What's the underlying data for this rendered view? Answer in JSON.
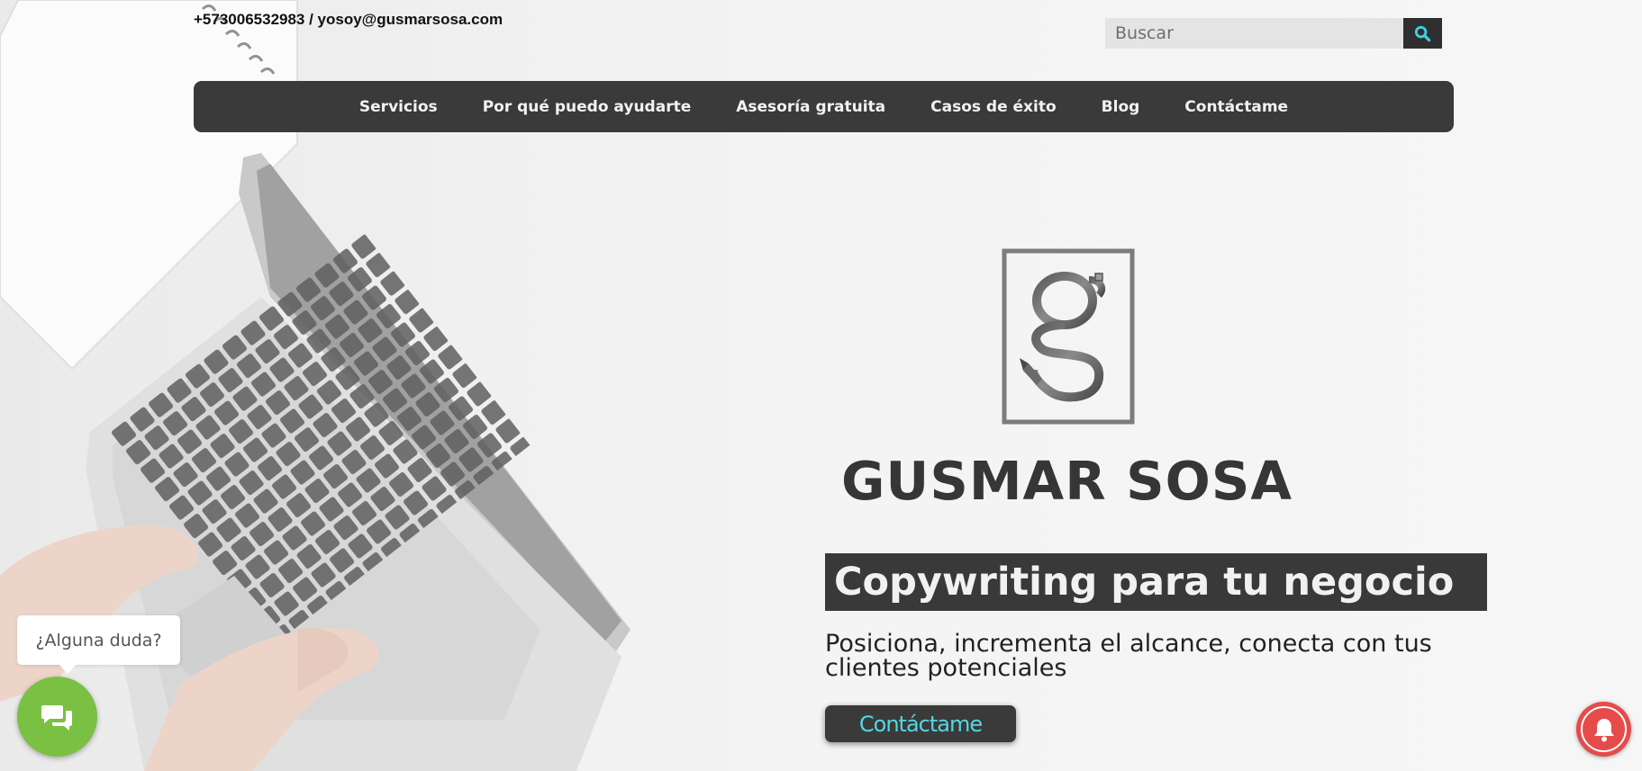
{
  "topbar": {
    "contact_text": "+573006532983 / yosoy@gusmarsosa.com"
  },
  "search": {
    "placeholder": "Buscar",
    "button_icon": "search-icon",
    "button_color": "#2f2f2f",
    "icon_color": "#3fd0e0"
  },
  "nav": {
    "items": [
      {
        "label": "Servicios"
      },
      {
        "label": "Por qué puedo ayudarte"
      },
      {
        "label": "Asesoría gratuita"
      },
      {
        "label": "Casos de éxito"
      },
      {
        "label": "Blog"
      },
      {
        "label": "Contáctame"
      }
    ]
  },
  "hero": {
    "logo_icon": "gs-monogram-logo",
    "brand_name": "GUSMAR SOSA",
    "headline": "Copywriting para tu negocio",
    "subheadline": "Posiciona, incrementa el alcance, conecta con tus clientes potenciales",
    "cta_label": "Contáctame",
    "accent_color": "#55d6e3",
    "dark_color": "#3a3a3a"
  },
  "chat_widget": {
    "tooltip_text": "¿Alguna duda?",
    "button_icon": "chat-bubbles-icon",
    "button_color": "#7ac043"
  },
  "notifications": {
    "button_icon": "bell-icon",
    "button_color": "#e54b4b"
  }
}
